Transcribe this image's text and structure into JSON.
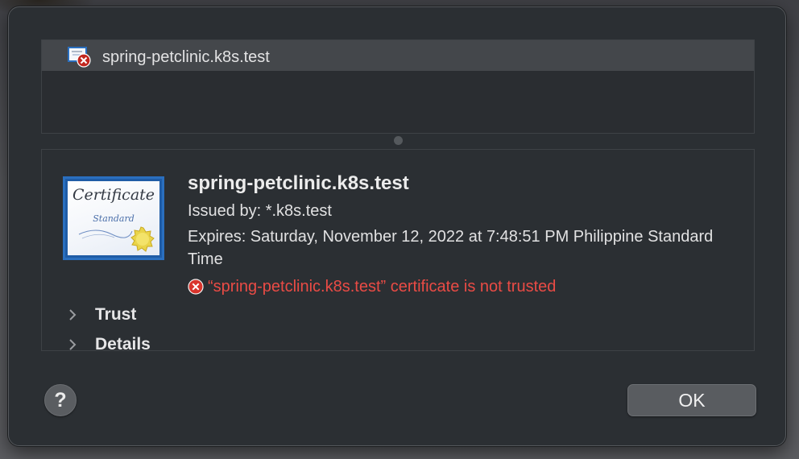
{
  "certificate_list": {
    "items": [
      {
        "label": "spring-petclinic.k8s.test",
        "icon": "certificate-untrusted-icon",
        "selected": true
      }
    ]
  },
  "certificate_detail": {
    "image": {
      "icon": "certificate-standard-icon",
      "title": "Certificate",
      "subtitle": "Standard"
    },
    "name": "spring-petclinic.k8s.test",
    "issued_by": "Issued by: *.k8s.test",
    "expires": "Expires: Saturday, November 12, 2022 at 7:48:51 PM Philippine Standard Time",
    "status": {
      "icon": "error-circle-icon",
      "text": "“spring-petclinic.k8s.test” certificate is not trusted",
      "color": "#ea4b45"
    },
    "sections": [
      {
        "label": "Trust",
        "expanded": false
      },
      {
        "label": "Details",
        "expanded": false
      }
    ]
  },
  "buttons": {
    "help_label": "?",
    "ok_label": "OK"
  },
  "colors": {
    "dialog_background": "#2b2f33",
    "selected_row": "#44474b",
    "certificate_border": "#2a6fbf",
    "error": "#ea4b45"
  }
}
